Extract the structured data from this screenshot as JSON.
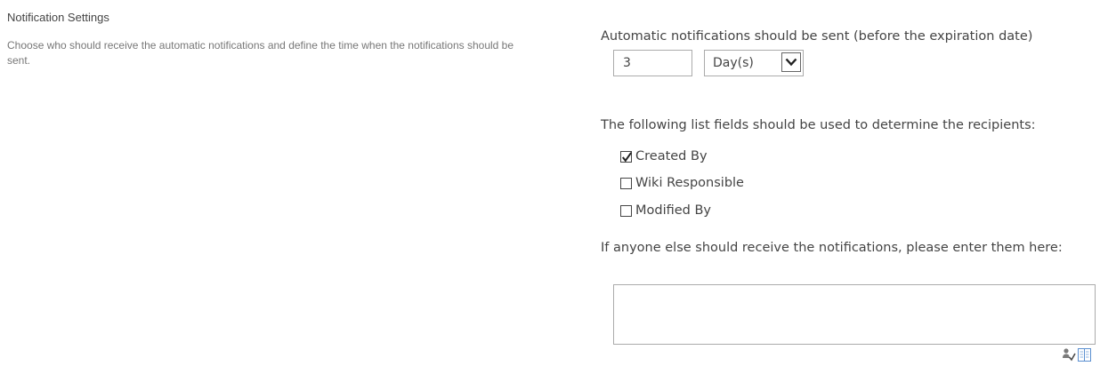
{
  "section": {
    "title": "Notification Settings",
    "description": "Choose who should receive the automatic notifications and define the time when the notifications should be sent."
  },
  "timing": {
    "label": "Automatic notifications should be sent (before the expiration date)",
    "amount_value": "3",
    "unit_selected": "Day(s)"
  },
  "recipients": {
    "label": "The following list fields should be used to determine the recipients:",
    "fields": [
      {
        "label": "Created By",
        "checked": true
      },
      {
        "label": "Wiki Responsible",
        "checked": false
      },
      {
        "label": "Modified By",
        "checked": false
      }
    ]
  },
  "additional": {
    "label": "If anyone else should receive the notifications, please enter them here:",
    "value": ""
  },
  "icons": {
    "check_names": "check-names-icon",
    "browse": "address-book-icon"
  }
}
